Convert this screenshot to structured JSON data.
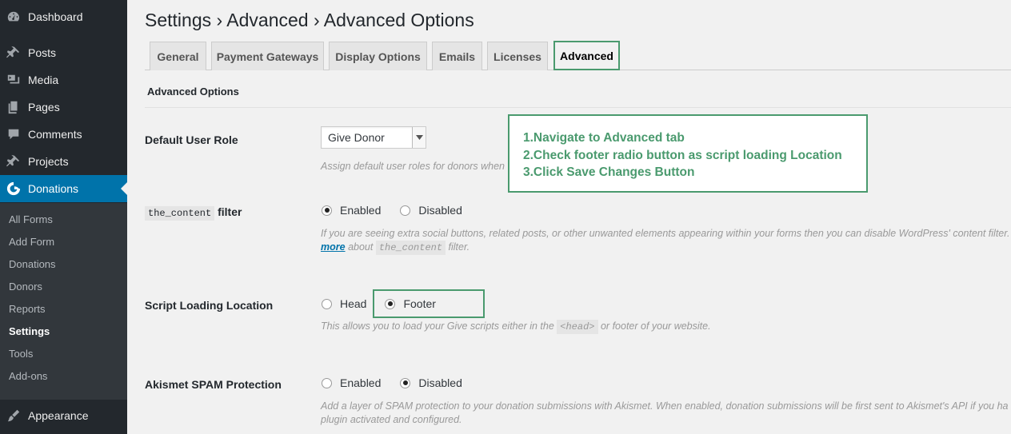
{
  "sidebar": {
    "items": [
      {
        "label": "Dashboard",
        "icon": "dashboard-icon"
      },
      {
        "label": "Posts",
        "icon": "pin-icon"
      },
      {
        "label": "Media",
        "icon": "media-icon"
      },
      {
        "label": "Pages",
        "icon": "pages-icon"
      },
      {
        "label": "Comments",
        "icon": "comments-icon"
      },
      {
        "label": "Projects",
        "icon": "pin-icon"
      },
      {
        "label": "Donations",
        "icon": "give-logo-icon"
      },
      {
        "label": "Appearance",
        "icon": "brush-icon"
      }
    ],
    "submenu": [
      "All Forms",
      "Add Form",
      "Donations",
      "Donors",
      "Reports",
      "Settings",
      "Tools",
      "Add-ons"
    ]
  },
  "header": {
    "title": "Settings › Advanced › Advanced Options"
  },
  "tabs": [
    "General",
    "Payment Gateways",
    "Display Options",
    "Emails",
    "Licenses",
    "Advanced"
  ],
  "section": {
    "title": "Advanced Options"
  },
  "fields": {
    "user_role": {
      "label": "Default User Role",
      "value": "Give Donor",
      "desc": "Assign default user roles for donors when"
    },
    "content_filter": {
      "code": "the_content",
      "label": "filter",
      "opt1": "Enabled",
      "opt2": "Disabled",
      "desc1": "If you are seeing extra social buttons, related posts, or other unwanted elements appearing within your forms then you can disable WordPress' content filter.",
      "link": "more",
      "desc2_pre": "about",
      "desc2_code": "the_content",
      "desc2_post": "filter."
    },
    "script_location": {
      "label": "Script Loading Location",
      "opt1": "Head",
      "opt2": "Footer",
      "desc_pre": "This allows you to load your Give scripts either in the",
      "desc_code": "<head>",
      "desc_post": "or footer of your website."
    },
    "akismet": {
      "label": "Akismet SPAM Protection",
      "opt1": "Enabled",
      "opt2": "Disabled",
      "desc1": "Add a layer of SPAM protection to your donation submissions with Akismet. When enabled, donation submissions will be first sent to Akismet's API if you ha",
      "desc2": "plugin activated and configured."
    }
  },
  "note": {
    "line1": "1.Navigate to Advanced tab",
    "line2": "2.Check footer radio button as script loading Location",
    "line3": "3.Click Save Changes Button"
  },
  "colors": {
    "sidebar": "#23282d",
    "active": "#0073aa",
    "highlight": "#4a9a6e"
  }
}
